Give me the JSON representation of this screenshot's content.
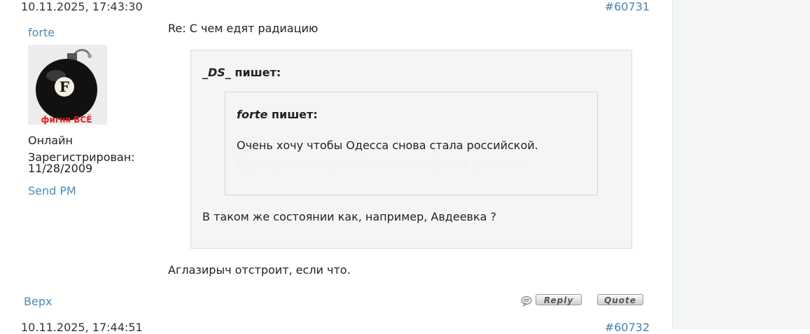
{
  "post1": {
    "timestamp": "10.11.2025, 17:43:30",
    "number": "#60731",
    "author": "forte",
    "avatar_caption": "фигня ВСЁ",
    "avatar_letter": "F",
    "status": "Онлайн",
    "registered_label": "Зарегистрирован:",
    "registered_date": "11/28/2009",
    "send_pm": "Send PM",
    "subject": "Re: С чем едят радиацию",
    "quote_outer": {
      "author": "_DS_",
      "says": "пишет:",
      "text": "В таком же состоянии как, например, Авдеевка ?"
    },
    "quote_inner": {
      "author": "forte",
      "says": "пишет:",
      "line1": "Очень хочу чтобы Одесса снова стала российской.",
      "line2": "Лучше, конечно, чтобы советской, но я реалист."
    },
    "body": "Аглазирыч отстроит, если что.",
    "top_link": "Верх",
    "reply_label": "Reply",
    "quote_label": "Quote"
  },
  "post2": {
    "timestamp": "10.11.2025, 17:44:51",
    "number": "#60732"
  }
}
